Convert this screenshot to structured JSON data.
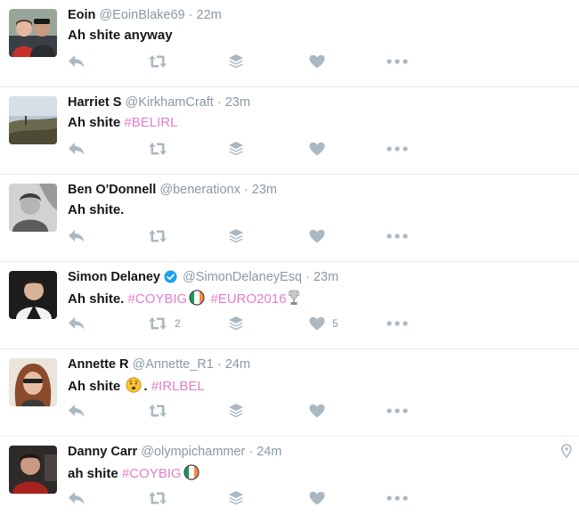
{
  "colors": {
    "hashtag": "#e07fce",
    "meta": "#8899a6",
    "icon": "#aab8c2",
    "verified": "#1da1f2"
  },
  "tweets": [
    {
      "name": "Eoin",
      "handle": "@EoinBlake69",
      "sep": "·",
      "time": "22m",
      "text": "Ah shite anyway",
      "retweets": "",
      "likes": ""
    },
    {
      "name": "Harriet S",
      "handle": "@KirkhamCraft",
      "sep": "·",
      "time": "23m",
      "text": "Ah shite",
      "hashtag1": "#BELIRL",
      "retweets": "",
      "likes": ""
    },
    {
      "name": "Ben O'Donnell",
      "handle": "@benerationx",
      "sep": "·",
      "time": "23m",
      "text": "Ah shite.",
      "retweets": "",
      "likes": ""
    },
    {
      "name": "Simon Delaney",
      "handle": "@SimonDelaneyEsq",
      "sep": "·",
      "time": "23m",
      "text": "Ah shite.",
      "hashtag1": "#COYBIG",
      "hashtag2": "#EURO2016",
      "retweets": "2",
      "likes": "5"
    },
    {
      "name": "Annette R",
      "handle": "@Annette_R1",
      "sep": "·",
      "time": "24m",
      "text": "Ah shite",
      "after_emoji": ".",
      "hashtag1": "#IRLBEL",
      "retweets": "",
      "likes": ""
    },
    {
      "name": "Danny Carr",
      "handle": "@olympichammer",
      "sep": "·",
      "time": "24m",
      "text": "ah shite",
      "hashtag1": "#COYBIG",
      "retweets": "",
      "likes": ""
    }
  ]
}
